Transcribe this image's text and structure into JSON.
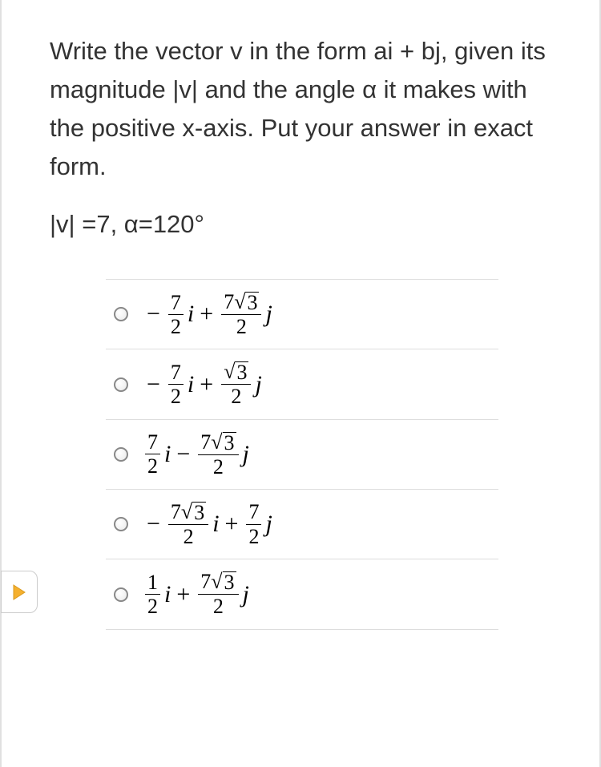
{
  "question": {
    "text": "Write the vector v in the form ai + bj, given its magnitude |v| and the angle α it makes with the positive x-axis. Put your answer in exact form.",
    "given": "|v| =7, α=120°"
  },
  "options": [
    {
      "a_sign": "−",
      "a_num": "7",
      "a_den": "2",
      "a_sqrt": null,
      "mid_op": "+",
      "b_sign": "",
      "b_num": "7",
      "b_sqrt": "3",
      "b_den": "2"
    },
    {
      "a_sign": "−",
      "a_num": "7",
      "a_den": "2",
      "a_sqrt": null,
      "mid_op": "+",
      "b_sign": "",
      "b_num": "",
      "b_sqrt": "3",
      "b_den": "2"
    },
    {
      "a_sign": "",
      "a_num": "7",
      "a_den": "2",
      "a_sqrt": null,
      "mid_op": "−",
      "b_sign": "",
      "b_num": "7",
      "b_sqrt": "3",
      "b_den": "2"
    },
    {
      "a_sign": "−",
      "a_num": "7",
      "a_sqrt": "3",
      "a_den": "2",
      "mid_op": "+",
      "b_sign": "",
      "b_num": "7",
      "b_sqrt": null,
      "b_den": "2"
    },
    {
      "a_sign": "",
      "a_num": "1",
      "a_den": "2",
      "a_sqrt": null,
      "mid_op": "+",
      "b_sign": "",
      "b_num": "7",
      "b_sqrt": "3",
      "b_den": "2"
    }
  ],
  "glyphs": {
    "i": "i",
    "j": "j"
  }
}
